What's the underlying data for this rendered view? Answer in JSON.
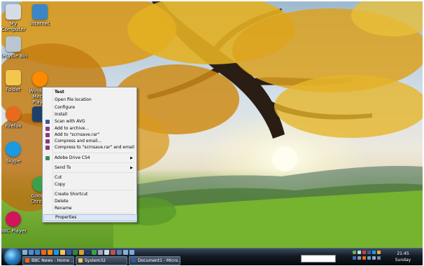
{
  "desktop_icons": [
    {
      "label": "My Computer",
      "icon": "computer-icon",
      "color": "#d6dce6"
    },
    {
      "label": "Recycle Bin",
      "icon": "recycle-bin-icon",
      "color": "#b9c6d2"
    },
    {
      "label": "Internet",
      "icon": "internet-explorer-icon",
      "color": "#3a86c8"
    },
    {
      "label": "Windows Media Player",
      "icon": "media-player-icon",
      "color": "#ff8a00"
    },
    {
      "label": "Folder",
      "icon": "folder-icon",
      "color": "#f3c64e"
    },
    {
      "label": "Firefox",
      "icon": "firefox-icon",
      "color": "#e86a1a"
    },
    {
      "label": "Skype",
      "icon": "skype-icon",
      "color": "#1a9ae0"
    },
    {
      "label": "BBC Player",
      "icon": "bbc-player-icon",
      "color": "#d4145a"
    },
    {
      "label": "Google Chrome",
      "icon": "chrome-icon",
      "color": "#3aa14a"
    },
    {
      "label": "Photoshop",
      "icon": "photoshop-icon",
      "color": "#1d3f6e"
    }
  ],
  "context_menu": {
    "items": [
      {
        "label": "Test",
        "bold": true
      },
      {
        "label": "Open file location"
      },
      {
        "label": "Configure"
      },
      {
        "label": "Install"
      },
      {
        "label": "Scan with AVG",
        "icon": "avg-icon"
      },
      {
        "label": "Add to archive...",
        "icon": "archive-icon"
      },
      {
        "label": "Add to \"scrnsave.rar\"",
        "icon": "archive-icon"
      },
      {
        "label": "Compress and email...",
        "icon": "archive-icon"
      },
      {
        "label": "Compress to \"scrnsave.rar\" and email",
        "icon": "archive-icon"
      },
      {
        "label": "Adobe Drive CS4",
        "icon": "adobe-drive-icon",
        "submenu": true
      },
      {
        "label": "Send To",
        "submenu": true
      },
      {
        "label": "Cut"
      },
      {
        "label": "Copy"
      },
      {
        "label": "Create Shortcut"
      },
      {
        "label": "Delete"
      },
      {
        "label": "Rename"
      },
      {
        "label": "Properties",
        "highlighted": true
      }
    ]
  },
  "taskbar": {
    "buttons": [
      {
        "label": "BBC News - Home ...",
        "icon": "firefox-icon"
      },
      {
        "label": "System32",
        "icon": "folder-icon"
      },
      {
        "label": "Document1 - Micro...",
        "icon": "word-icon"
      }
    ],
    "clock": {
      "time": "21:45",
      "day": "Sunday"
    }
  },
  "colors": {
    "menu_bg": "#f1f1f1",
    "menu_highlight": "#dce6f4",
    "taskbar": "#141b24"
  }
}
